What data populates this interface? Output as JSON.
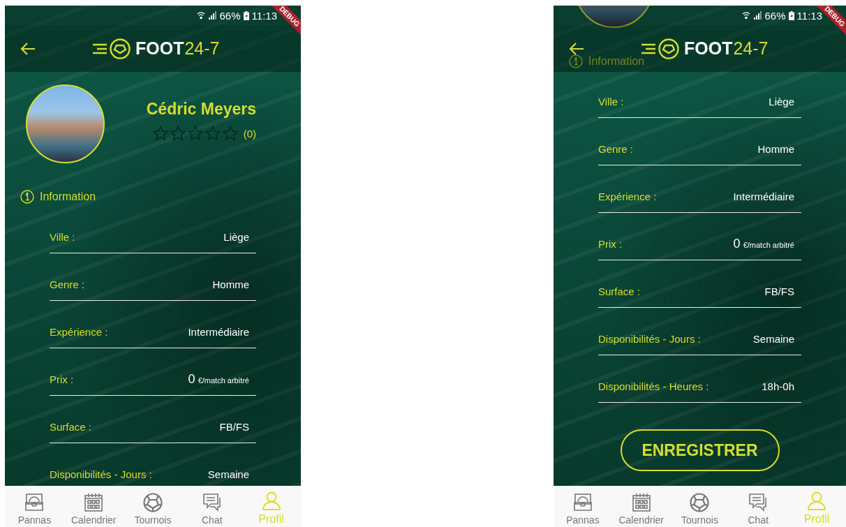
{
  "screens": [
    {
      "scrolled": false,
      "status_bar": {
        "battery": "66%",
        "time": "11:13"
      },
      "debug_banner": "DEBUG",
      "header": {
        "logo_text": "FOOT",
        "logo_accent": "24-7"
      },
      "profile": {
        "name": "Cédric Meyers",
        "stars": 0,
        "rating_count": "(0)"
      },
      "section_title": "Information",
      "fields": [
        {
          "label": "Ville :",
          "value": "Liège"
        },
        {
          "label": "Genre :",
          "value": "Homme"
        },
        {
          "label": "Expérience :",
          "value": "Intermédiaire"
        },
        {
          "label": "Prix :",
          "value": "0",
          "unit": "€/match arbitré"
        },
        {
          "label": "Surface :",
          "value": "FB/FS"
        },
        {
          "label": "Disponibilités - Jours :",
          "value": "Semaine"
        }
      ],
      "nav": [
        {
          "label": "Pannas",
          "selected": false
        },
        {
          "label": "Calendrier",
          "selected": false
        },
        {
          "label": "Tournois",
          "selected": false
        },
        {
          "label": "Chat",
          "selected": false
        },
        {
          "label": "Profil",
          "selected": true
        }
      ]
    },
    {
      "scrolled": true,
      "status_bar": {
        "battery": "66%",
        "time": "11:13"
      },
      "debug_banner": "DEBUG",
      "header": {
        "logo_text": "FOOT",
        "logo_accent": "24-7"
      },
      "section_title": "Information",
      "fields": [
        {
          "label": "Ville :",
          "value": "Liège"
        },
        {
          "label": "Genre :",
          "value": "Homme"
        },
        {
          "label": "Expérience :",
          "value": "Intermédiaire"
        },
        {
          "label": "Prix :",
          "value": "0",
          "unit": "€/match arbitré"
        },
        {
          "label": "Surface :",
          "value": "FB/FS"
        },
        {
          "label": "Disponibilités - Jours :",
          "value": "Semaine"
        },
        {
          "label": "Disponibilités - Heures :",
          "value": "18h-0h"
        }
      ],
      "save_button": "ENREGISTRER",
      "nav": [
        {
          "label": "Pannas",
          "selected": false
        },
        {
          "label": "Calendrier",
          "selected": false
        },
        {
          "label": "Tournois",
          "selected": false
        },
        {
          "label": "Chat",
          "selected": false
        },
        {
          "label": "Profil",
          "selected": true
        }
      ]
    }
  ]
}
